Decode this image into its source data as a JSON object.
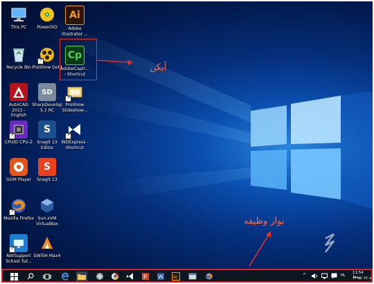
{
  "desktop": {
    "icons": [
      {
        "label": "This PC"
      },
      {
        "label": "PowerISO"
      },
      {
        "label": "Adobe Illustrator ...",
        "glyph_text": "Ai"
      },
      {
        "label": "Recycle Bin"
      },
      {
        "label": "ProShow Gold"
      },
      {
        "label": "AdobeCapti... - Shortcut",
        "glyph_text": "Cp"
      },
      {
        "label": "AutoCAD 2015 - English"
      },
      {
        "label": "SharpDevelop 5.1 RC",
        "glyph_text": "SD"
      },
      {
        "label": "ProShow Slideshow..."
      },
      {
        "label": "CPUID CPU-Z"
      },
      {
        "label": "Snagit 13 Editor",
        "glyph_text": "S"
      },
      {
        "label": "WDExpress - Shortcut"
      },
      {
        "label": "GOM Player"
      },
      {
        "label": "Snagit 13",
        "glyph_text": "S"
      },
      {
        "label": "Mozilla Firefox"
      },
      {
        "label": "Sun.xVM VirtualBox"
      },
      {
        "label": "NetSupport School Tut..."
      },
      {
        "label": "SWiSH Max4"
      }
    ]
  },
  "annotations": {
    "icon_label": "آیکن",
    "taskbar_label": "نوار وظیفه"
  },
  "taskbar": {
    "clock_time": "11:54 ب.ظ",
    "clock_date": "۱۳۹۵/۰۳/۰۸",
    "tray_lang": "FA"
  },
  "colors": {
    "annotation": "#e0322b",
    "taskbar_bg": "#0d1620",
    "desktop_accent": "#2a86e0"
  }
}
